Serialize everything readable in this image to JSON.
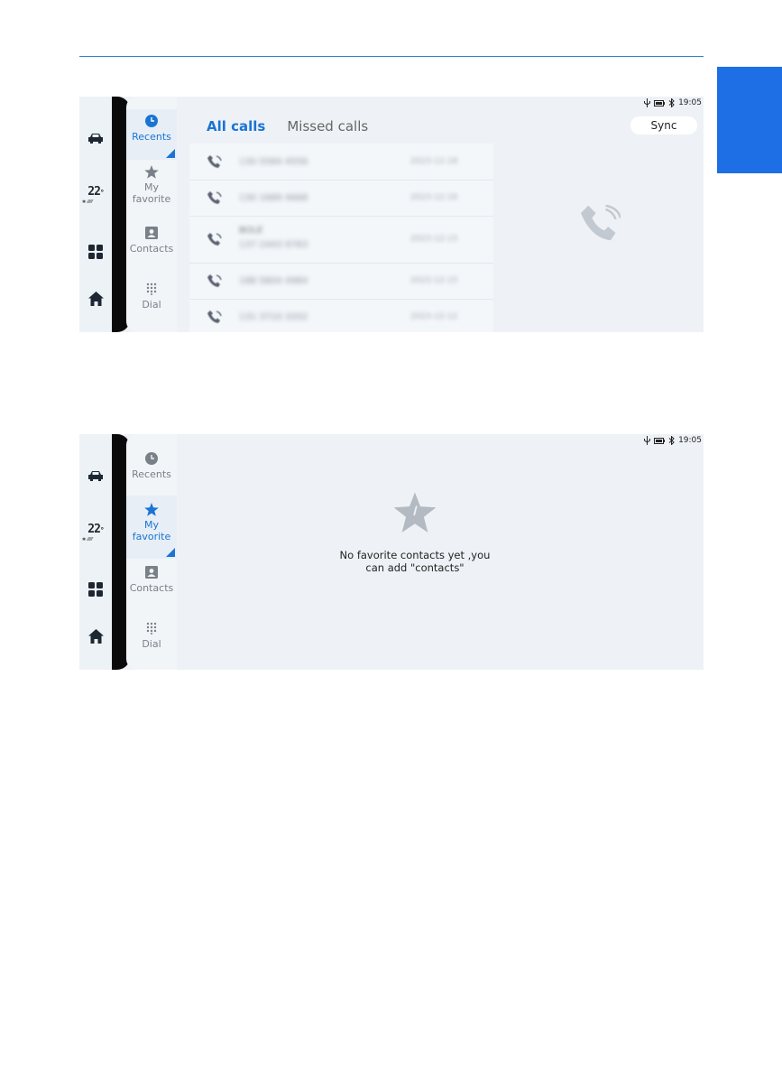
{
  "screen1": {
    "status_time": "19:05",
    "left_bar": {
      "temperature": "22",
      "temp_unit": "°"
    },
    "nav": [
      {
        "label": "Recents",
        "icon": "clock-icon",
        "active": true
      },
      {
        "label": "My\nfavorite",
        "icon": "star-icon",
        "active": false
      },
      {
        "label": "Contacts",
        "icon": "contact-card-icon",
        "active": false
      },
      {
        "label": "Dial",
        "icon": "dialpad-icon",
        "active": false
      }
    ],
    "tabs": {
      "all": "All calls",
      "missed": "Missed calls"
    },
    "sync_label": "Sync",
    "calls": [
      {
        "number": "130 5584 4556",
        "name": "",
        "date": "2023-12-18"
      },
      {
        "number": "130 1689 4668",
        "name": "",
        "date": "2023-12-16"
      },
      {
        "number": "137 2443 9783",
        "name": "BOLE",
        "date": "2023-12-15"
      },
      {
        "number": "188 5804 4984",
        "name": "",
        "date": "2023-12-15"
      },
      {
        "number": "131 3710 3202",
        "name": "",
        "date": "2023-12-12"
      }
    ]
  },
  "screen2": {
    "status_time": "19:05",
    "left_bar": {
      "temperature": "22",
      "temp_unit": "°"
    },
    "nav": [
      {
        "label": "Recents",
        "icon": "clock-icon",
        "active": false
      },
      {
        "label": "My\nfavorite",
        "icon": "star-icon",
        "active": true
      },
      {
        "label": "Contacts",
        "icon": "contact-card-icon",
        "active": false
      },
      {
        "label": "Dial",
        "icon": "dialpad-icon",
        "active": false
      }
    ],
    "empty_message_line1": "No favorite contacts yet ,you",
    "empty_message_line2": "can add \"contacts\""
  },
  "colors": {
    "accent": "#1a74d4",
    "side_tab": "#1e6fe6",
    "screen_bg": "#eef2f6"
  }
}
